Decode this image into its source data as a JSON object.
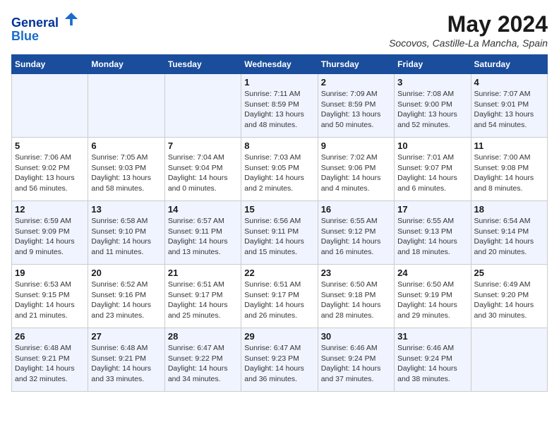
{
  "header": {
    "logo_line1": "General",
    "logo_line2": "Blue",
    "month_title": "May 2024",
    "location": "Socovos, Castille-La Mancha, Spain"
  },
  "weekdays": [
    "Sunday",
    "Monday",
    "Tuesday",
    "Wednesday",
    "Thursday",
    "Friday",
    "Saturday"
  ],
  "weeks": [
    [
      {
        "day": "",
        "sunrise": "",
        "sunset": "",
        "daylight": ""
      },
      {
        "day": "",
        "sunrise": "",
        "sunset": "",
        "daylight": ""
      },
      {
        "day": "",
        "sunrise": "",
        "sunset": "",
        "daylight": ""
      },
      {
        "day": "1",
        "sunrise": "Sunrise: 7:11 AM",
        "sunset": "Sunset: 8:59 PM",
        "daylight": "Daylight: 13 hours and 48 minutes."
      },
      {
        "day": "2",
        "sunrise": "Sunrise: 7:09 AM",
        "sunset": "Sunset: 8:59 PM",
        "daylight": "Daylight: 13 hours and 50 minutes."
      },
      {
        "day": "3",
        "sunrise": "Sunrise: 7:08 AM",
        "sunset": "Sunset: 9:00 PM",
        "daylight": "Daylight: 13 hours and 52 minutes."
      },
      {
        "day": "4",
        "sunrise": "Sunrise: 7:07 AM",
        "sunset": "Sunset: 9:01 PM",
        "daylight": "Daylight: 13 hours and 54 minutes."
      }
    ],
    [
      {
        "day": "5",
        "sunrise": "Sunrise: 7:06 AM",
        "sunset": "Sunset: 9:02 PM",
        "daylight": "Daylight: 13 hours and 56 minutes."
      },
      {
        "day": "6",
        "sunrise": "Sunrise: 7:05 AM",
        "sunset": "Sunset: 9:03 PM",
        "daylight": "Daylight: 13 hours and 58 minutes."
      },
      {
        "day": "7",
        "sunrise": "Sunrise: 7:04 AM",
        "sunset": "Sunset: 9:04 PM",
        "daylight": "Daylight: 14 hours and 0 minutes."
      },
      {
        "day": "8",
        "sunrise": "Sunrise: 7:03 AM",
        "sunset": "Sunset: 9:05 PM",
        "daylight": "Daylight: 14 hours and 2 minutes."
      },
      {
        "day": "9",
        "sunrise": "Sunrise: 7:02 AM",
        "sunset": "Sunset: 9:06 PM",
        "daylight": "Daylight: 14 hours and 4 minutes."
      },
      {
        "day": "10",
        "sunrise": "Sunrise: 7:01 AM",
        "sunset": "Sunset: 9:07 PM",
        "daylight": "Daylight: 14 hours and 6 minutes."
      },
      {
        "day": "11",
        "sunrise": "Sunrise: 7:00 AM",
        "sunset": "Sunset: 9:08 PM",
        "daylight": "Daylight: 14 hours and 8 minutes."
      }
    ],
    [
      {
        "day": "12",
        "sunrise": "Sunrise: 6:59 AM",
        "sunset": "Sunset: 9:09 PM",
        "daylight": "Daylight: 14 hours and 9 minutes."
      },
      {
        "day": "13",
        "sunrise": "Sunrise: 6:58 AM",
        "sunset": "Sunset: 9:10 PM",
        "daylight": "Daylight: 14 hours and 11 minutes."
      },
      {
        "day": "14",
        "sunrise": "Sunrise: 6:57 AM",
        "sunset": "Sunset: 9:11 PM",
        "daylight": "Daylight: 14 hours and 13 minutes."
      },
      {
        "day": "15",
        "sunrise": "Sunrise: 6:56 AM",
        "sunset": "Sunset: 9:11 PM",
        "daylight": "Daylight: 14 hours and 15 minutes."
      },
      {
        "day": "16",
        "sunrise": "Sunrise: 6:55 AM",
        "sunset": "Sunset: 9:12 PM",
        "daylight": "Daylight: 14 hours and 16 minutes."
      },
      {
        "day": "17",
        "sunrise": "Sunrise: 6:55 AM",
        "sunset": "Sunset: 9:13 PM",
        "daylight": "Daylight: 14 hours and 18 minutes."
      },
      {
        "day": "18",
        "sunrise": "Sunrise: 6:54 AM",
        "sunset": "Sunset: 9:14 PM",
        "daylight": "Daylight: 14 hours and 20 minutes."
      }
    ],
    [
      {
        "day": "19",
        "sunrise": "Sunrise: 6:53 AM",
        "sunset": "Sunset: 9:15 PM",
        "daylight": "Daylight: 14 hours and 21 minutes."
      },
      {
        "day": "20",
        "sunrise": "Sunrise: 6:52 AM",
        "sunset": "Sunset: 9:16 PM",
        "daylight": "Daylight: 14 hours and 23 minutes."
      },
      {
        "day": "21",
        "sunrise": "Sunrise: 6:51 AM",
        "sunset": "Sunset: 9:17 PM",
        "daylight": "Daylight: 14 hours and 25 minutes."
      },
      {
        "day": "22",
        "sunrise": "Sunrise: 6:51 AM",
        "sunset": "Sunset: 9:17 PM",
        "daylight": "Daylight: 14 hours and 26 minutes."
      },
      {
        "day": "23",
        "sunrise": "Sunrise: 6:50 AM",
        "sunset": "Sunset: 9:18 PM",
        "daylight": "Daylight: 14 hours and 28 minutes."
      },
      {
        "day": "24",
        "sunrise": "Sunrise: 6:50 AM",
        "sunset": "Sunset: 9:19 PM",
        "daylight": "Daylight: 14 hours and 29 minutes."
      },
      {
        "day": "25",
        "sunrise": "Sunrise: 6:49 AM",
        "sunset": "Sunset: 9:20 PM",
        "daylight": "Daylight: 14 hours and 30 minutes."
      }
    ],
    [
      {
        "day": "26",
        "sunrise": "Sunrise: 6:48 AM",
        "sunset": "Sunset: 9:21 PM",
        "daylight": "Daylight: 14 hours and 32 minutes."
      },
      {
        "day": "27",
        "sunrise": "Sunrise: 6:48 AM",
        "sunset": "Sunset: 9:21 PM",
        "daylight": "Daylight: 14 hours and 33 minutes."
      },
      {
        "day": "28",
        "sunrise": "Sunrise: 6:47 AM",
        "sunset": "Sunset: 9:22 PM",
        "daylight": "Daylight: 14 hours and 34 minutes."
      },
      {
        "day": "29",
        "sunrise": "Sunrise: 6:47 AM",
        "sunset": "Sunset: 9:23 PM",
        "daylight": "Daylight: 14 hours and 36 minutes."
      },
      {
        "day": "30",
        "sunrise": "Sunrise: 6:46 AM",
        "sunset": "Sunset: 9:24 PM",
        "daylight": "Daylight: 14 hours and 37 minutes."
      },
      {
        "day": "31",
        "sunrise": "Sunrise: 6:46 AM",
        "sunset": "Sunset: 9:24 PM",
        "daylight": "Daylight: 14 hours and 38 minutes."
      },
      {
        "day": "",
        "sunrise": "",
        "sunset": "",
        "daylight": ""
      }
    ]
  ]
}
